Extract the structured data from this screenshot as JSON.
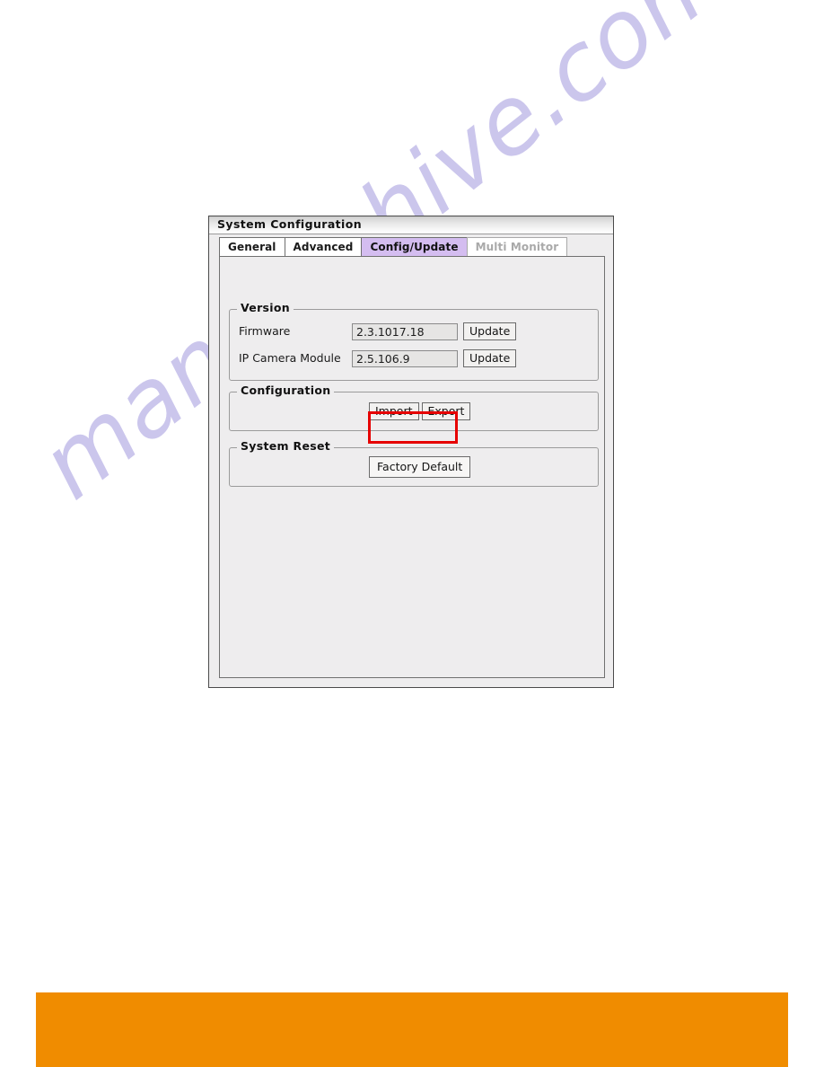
{
  "window": {
    "title": "System Configuration"
  },
  "tabs": [
    {
      "label": "General",
      "state": "normal"
    },
    {
      "label": "Advanced",
      "state": "normal"
    },
    {
      "label": "Config/Update",
      "state": "active"
    },
    {
      "label": "Multi Monitor",
      "state": "disabled"
    }
  ],
  "groups": {
    "version": {
      "title": "Version",
      "rows": [
        {
          "label": "Firmware",
          "value": "2.3.1017.18",
          "button": "Update"
        },
        {
          "label": "IP Camera Module",
          "value": "2.5.106.9",
          "button": "Update"
        }
      ]
    },
    "configuration": {
      "title": "Configuration",
      "import_label": "Import",
      "export_label": "Export"
    },
    "system_reset": {
      "title": "System Reset",
      "factory_default_label": "Factory Default"
    }
  },
  "watermark": {
    "text": "manualshive.com"
  },
  "colors": {
    "active_tab": "#d4bdf0",
    "annotation": "#e60000",
    "footer_bar": "#f08c00",
    "dialog_face": "#eeedee",
    "watermark": "#c9c4ec"
  }
}
